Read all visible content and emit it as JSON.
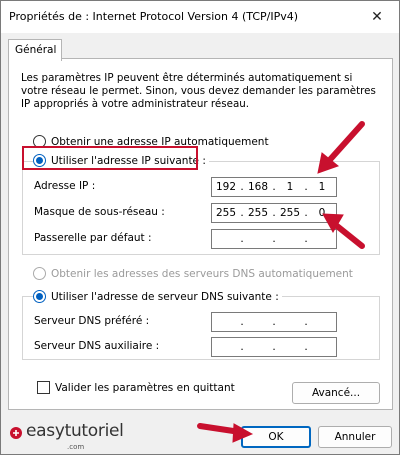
{
  "window": {
    "title": "Propriétés de : Internet Protocol Version 4 (TCP/IPv4)",
    "close_glyph": "✕"
  },
  "tabs": [
    {
      "label": "Général",
      "active": true
    }
  ],
  "intro_text": "Les paramètres IP peuvent être déterminés automatiquement si votre réseau le permet. Sinon, vous devez demander les paramètres IP appropriés à votre administrateur réseau.",
  "ip_mode": {
    "auto_label": "Obtenir une adresse IP automatiquement",
    "manual_label": "Utiliser l'adresse IP suivante :",
    "selected": "manual"
  },
  "ip_fields": [
    {
      "label": "Adresse IP :",
      "octets": [
        "192",
        "168",
        "1",
        "1"
      ]
    },
    {
      "label": "Masque de sous-réseau :",
      "octets": [
        "255",
        "255",
        "255",
        "0"
      ]
    },
    {
      "label": "Passerelle par défaut :",
      "octets": [
        "",
        "",
        "",
        ""
      ]
    }
  ],
  "dns_mode": {
    "auto_label": "Obtenir les adresses des serveurs DNS automatiquement",
    "manual_label": "Utiliser l'adresse de serveur DNS suivante :",
    "selected": "manual",
    "auto_disabled": true
  },
  "dns_fields": [
    {
      "label": "Serveur DNS préféré :",
      "octets": [
        "",
        "",
        "",
        ""
      ]
    },
    {
      "label": "Serveur DNS auxiliaire :",
      "octets": [
        "",
        "",
        "",
        ""
      ]
    }
  ],
  "validate_checkbox": {
    "label": "Valider les paramètres en quittant",
    "checked": false
  },
  "buttons": {
    "advanced": "Avancé...",
    "ok": "OK",
    "cancel": "Annuler"
  },
  "watermark": {
    "text": "easytutoriel",
    "sub": ".com"
  },
  "colors": {
    "accent": "#0067c0",
    "annotation_red": "#c8102e"
  }
}
